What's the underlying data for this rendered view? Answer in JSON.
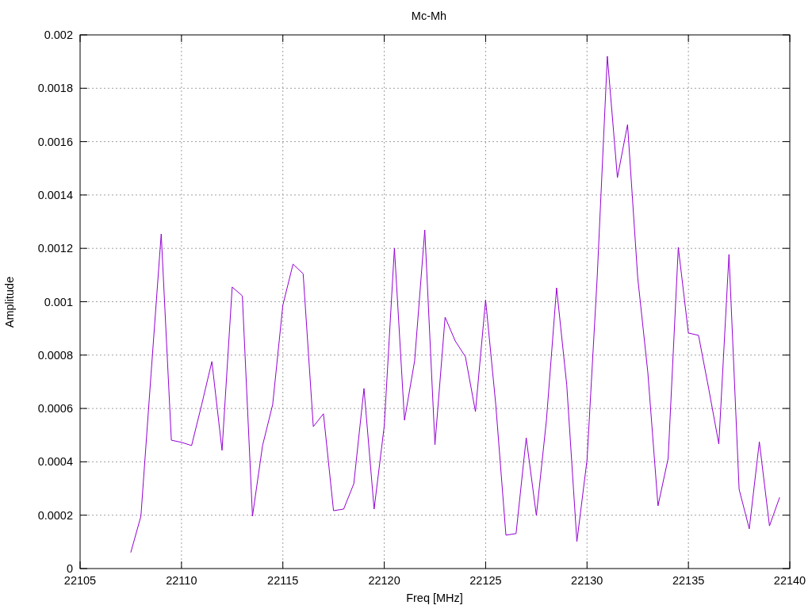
{
  "chart_data": {
    "type": "line",
    "title": "Mc-Mh",
    "xlabel": "Freq [MHz]",
    "ylabel": "Amplitude",
    "x": [
      22107.5,
      22108,
      22108.5,
      22109,
      22109.5,
      22110,
      22110.5,
      22111,
      22111.5,
      22112,
      22112.5,
      22113,
      22113.5,
      22114,
      22114.5,
      22115,
      22115.5,
      22116,
      22116.5,
      22117,
      22117.5,
      22118,
      22118.5,
      22119,
      22119.5,
      22120,
      22120.5,
      22121,
      22121.5,
      22122,
      22122.5,
      22123,
      22123.5,
      22124,
      22124.5,
      22125,
      22125.5,
      22126,
      22126.5,
      22127,
      22127.5,
      22128,
      22128.5,
      22129,
      22129.5,
      22130,
      22130.5,
      22131,
      22131.5,
      22132,
      22132.5,
      22133,
      22133.5,
      22134,
      22134.5,
      22135,
      22135.5,
      22136,
      22136.5,
      22137,
      22137.5,
      22138,
      22138.5,
      22139,
      22139.5
    ],
    "series": [
      {
        "color": "#9400d3",
        "values": [
          6e-05,
          0.000196,
          0.00073,
          0.001254,
          0.000481,
          0.000473,
          0.000461,
          0.000615,
          0.000776,
          0.000443,
          0.001055,
          0.001022,
          0.000196,
          0.000461,
          0.000615,
          0.000987,
          0.001141,
          0.001105,
          0.000532,
          0.00058,
          0.000217,
          0.000223,
          0.000318,
          0.000675,
          0.000223,
          0.000535,
          0.001201,
          0.000556,
          0.000779,
          0.001269,
          0.000464,
          0.000942,
          0.000853,
          0.000794,
          0.000588,
          0.001007,
          0.000615,
          0.000125,
          0.000131,
          0.00049,
          0.000199,
          0.000556,
          0.001052,
          0.000689,
          0.000101,
          0.000407,
          0.001091,
          0.00192,
          0.001465,
          0.001664,
          0.001091,
          0.000734,
          0.000235,
          0.000413,
          0.001204,
          0.000883,
          0.000874,
          0.000675,
          0.000467,
          0.001177,
          0.000297,
          0.000149,
          0.000475,
          0.00016,
          0.000267
        ]
      }
    ],
    "grid": true,
    "xlim": [
      22105,
      22140
    ],
    "ylim": [
      0,
      0.002
    ],
    "xticks": [
      22105,
      22110,
      22115,
      22120,
      22125,
      22130,
      22135,
      22140
    ],
    "yticks": [
      0,
      0.0002,
      0.0004,
      0.0006,
      0.0008,
      0.001,
      0.0012,
      0.0014,
      0.0016,
      0.0018,
      0.002
    ]
  }
}
